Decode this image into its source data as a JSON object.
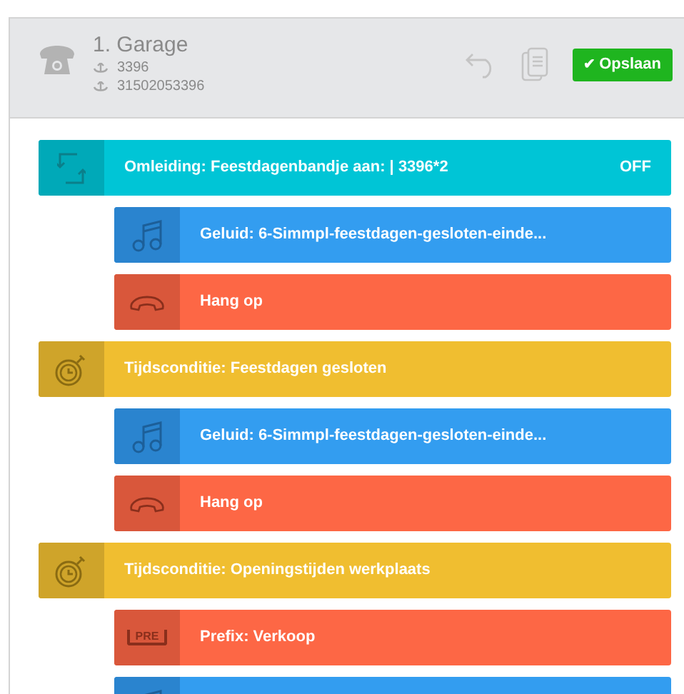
{
  "header": {
    "title": "1. Garage",
    "numbers": [
      "3396",
      "31502053396"
    ],
    "save_button": {
      "icon": "✔",
      "label": "Opslaan"
    }
  },
  "flow": [
    {
      "kind": "redirect",
      "label": "Omleiding: Feestdagenbandje aan: | 3396*2",
      "status": "OFF",
      "children": [
        {
          "kind": "sound",
          "label": "Geluid: 6-Simmpl-feestdagen-gesloten-einde..."
        },
        {
          "kind": "hangup",
          "label": "Hang op"
        }
      ]
    },
    {
      "kind": "time",
      "label": "Tijdsconditie: Feestdagen gesloten",
      "children": [
        {
          "kind": "sound",
          "label": "Geluid: 6-Simmpl-feestdagen-gesloten-einde..."
        },
        {
          "kind": "hangup",
          "label": "Hang op"
        }
      ]
    },
    {
      "kind": "time",
      "label": "Tijdsconditie: Openingstijden werkplaats",
      "children": [
        {
          "kind": "prefix",
          "label": "Prefix: Verkoop",
          "icon_text": "PRE"
        },
        {
          "kind": "sound"
        }
      ]
    }
  ]
}
